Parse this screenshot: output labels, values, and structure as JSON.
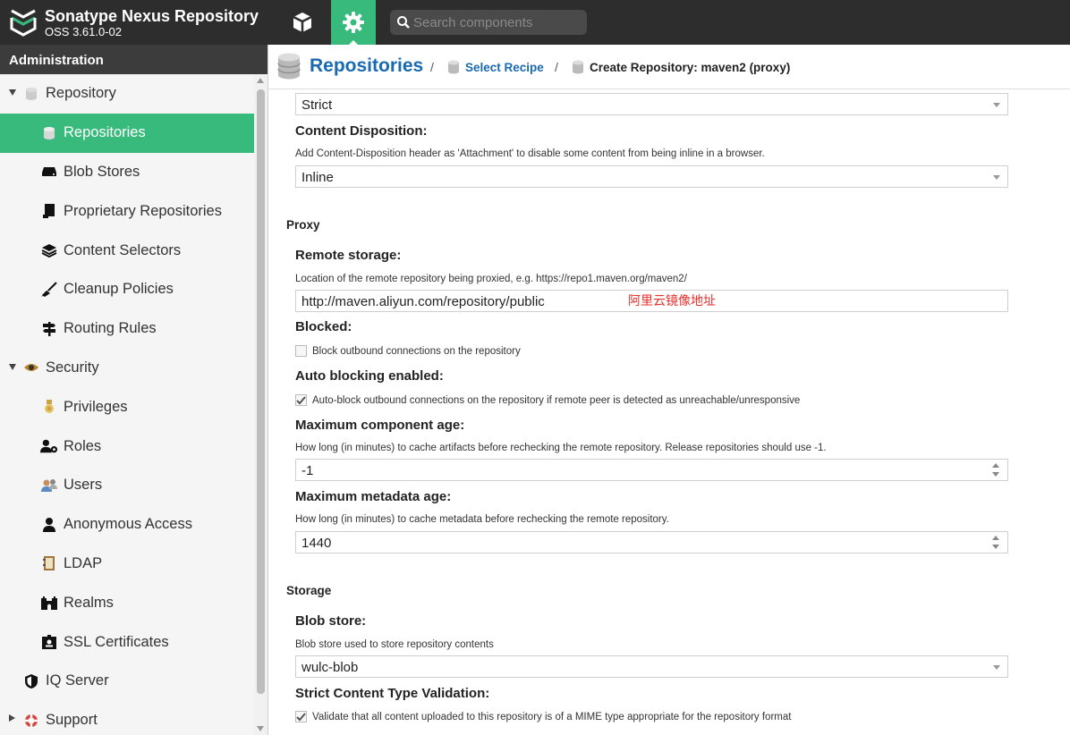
{
  "app": {
    "name": "Sonatype Nexus Repository",
    "version": "OSS 3.61.0-02"
  },
  "header": {
    "search_placeholder": "Search components"
  },
  "sidebar": {
    "title": "Administration",
    "items": [
      {
        "label": "Repository",
        "icon": "database-icon",
        "level": 0,
        "expanded": true
      },
      {
        "label": "Repositories",
        "icon": "database-icon",
        "level": 1,
        "active": true
      },
      {
        "label": "Blob Stores",
        "icon": "hdd-icon",
        "level": 1
      },
      {
        "label": "Proprietary Repositories",
        "icon": "book-icon",
        "level": 1
      },
      {
        "label": "Content Selectors",
        "icon": "layers-icon",
        "level": 1
      },
      {
        "label": "Cleanup Policies",
        "icon": "broom-icon",
        "level": 1
      },
      {
        "label": "Routing Rules",
        "icon": "signpost-icon",
        "level": 1
      },
      {
        "label": "Security",
        "icon": "eye-icon",
        "level": 0,
        "expanded": true
      },
      {
        "label": "Privileges",
        "icon": "medal-icon",
        "level": 1
      },
      {
        "label": "Roles",
        "icon": "user-cog-icon",
        "level": 1
      },
      {
        "label": "Users",
        "icon": "users-icon",
        "level": 1
      },
      {
        "label": "Anonymous Access",
        "icon": "user-icon",
        "level": 1
      },
      {
        "label": "LDAP",
        "icon": "address-book-icon",
        "level": 1
      },
      {
        "label": "Realms",
        "icon": "castle-icon",
        "level": 1
      },
      {
        "label": "SSL Certificates",
        "icon": "id-badge-icon",
        "level": 1
      },
      {
        "label": "IQ Server",
        "icon": "shield-icon",
        "level": 0
      },
      {
        "label": "Support",
        "icon": "lifebuoy-icon",
        "level": 0,
        "expanded": false
      }
    ]
  },
  "breadcrumb": {
    "root": "Repositories",
    "sep": "/",
    "items": [
      "Select Recipe",
      "Create Repository: maven2 (proxy)"
    ]
  },
  "form": {
    "strict_value": "Strict",
    "content_disposition": {
      "title": "Content Disposition:",
      "help": "Add Content-Disposition header as 'Attachment' to disable some content from being inline in a browser.",
      "value": "Inline"
    },
    "proxy_section": "Proxy",
    "remote_storage": {
      "title": "Remote storage:",
      "help": "Location of the remote repository being proxied, e.g. https://repo1.maven.org/maven2/",
      "value": "http://maven.aliyun.com/repository/public",
      "annotation": "阿里云镜像地址"
    },
    "blocked": {
      "title": "Blocked:",
      "label": "Block outbound connections on the repository",
      "checked": false
    },
    "auto_blocking": {
      "title": "Auto blocking enabled:",
      "label": "Auto-block outbound connections on the repository if remote peer is detected as unreachable/unresponsive",
      "checked": true
    },
    "max_component_age": {
      "title": "Maximum component age:",
      "help": "How long (in minutes) to cache artifacts before rechecking the remote repository. Release repositories should use -1.",
      "value": "-1"
    },
    "max_metadata_age": {
      "title": "Maximum metadata age:",
      "help": "How long (in minutes) to cache metadata before rechecking the remote repository.",
      "value": "1440"
    },
    "storage_section": "Storage",
    "blob_store": {
      "title": "Blob store:",
      "help": "Blob store used to store repository contents",
      "value": "wulc-blob"
    },
    "strict_content": {
      "title": "Strict Content Type Validation:",
      "label": "Validate that all content uploaded to this repository is of a MIME type appropriate for the repository format",
      "checked": true
    }
  },
  "colors": {
    "accent": "#38ba7d",
    "header_bg": "#2d2d2d",
    "link": "#1a6ab1",
    "annotation": "#e8302e"
  }
}
